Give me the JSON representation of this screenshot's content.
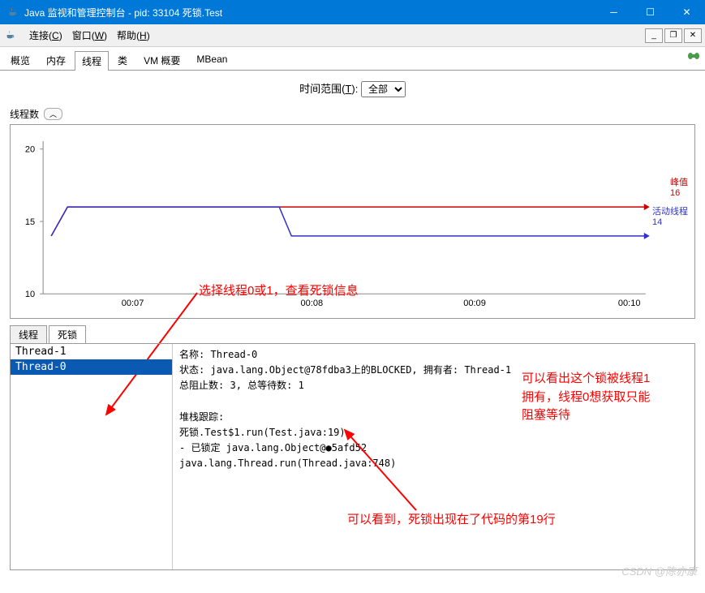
{
  "titlebar": {
    "title": "Java 监视和管理控制台 - pid: 33104 死锁.Test"
  },
  "menubar": {
    "connect": "连接",
    "connect_key": "C",
    "window": "窗口",
    "window_key": "W",
    "help": "帮助",
    "help_key": "H"
  },
  "tabs": {
    "overview": "概览",
    "memory": "内存",
    "threads": "线程",
    "classes": "类",
    "vm": "VM 概要",
    "mbeans": "MBean"
  },
  "time_range": {
    "label": "时间范围(",
    "key": "T",
    "suffix": "):",
    "value": "全部"
  },
  "chart": {
    "title": "线程数",
    "legend_peak": "峰值",
    "legend_peak_val": "16",
    "legend_active": "活动线程",
    "legend_active_val": "14",
    "y_max": "20",
    "y_mid": "15",
    "y_min": "10",
    "x_labels": [
      "00:07",
      "00:08",
      "00:09",
      "00:10"
    ]
  },
  "chart_data": {
    "type": "line",
    "title": "线程数",
    "xlabel": "",
    "ylabel": "",
    "ylim": [
      10,
      20
    ],
    "x": [
      "00:07",
      "00:08",
      "00:09",
      "00:10"
    ],
    "series": [
      {
        "name": "峰值",
        "color": "#cc0000",
        "values": [
          14,
          16,
          16,
          16,
          16
        ]
      },
      {
        "name": "活动线程",
        "color": "#3030cc",
        "values": [
          14,
          16,
          16,
          14,
          14,
          14
        ]
      }
    ]
  },
  "subtabs": {
    "threads": "线程",
    "deadlock": "死锁"
  },
  "thread_list": [
    "Thread-1",
    "Thread-0"
  ],
  "selected_thread": "Thread-0",
  "detail": {
    "name_label": "名称:",
    "name_value": "Thread-0",
    "state_label": "状态:",
    "state_value": "java.lang.Object@78fdba3上的BLOCKED, 拥有者: Thread-1",
    "blocked_label": "总阻止数:",
    "blocked_value": "3,",
    "waited_label": "总等待数:",
    "waited_value": "1",
    "stack_label": "堆栈跟踪:",
    "line1": "死锁.Test$1.run(Test.java:19)",
    "line2": "   - 已锁定 java.lang.Object@",
    "line2_obscured": "5afd52",
    "line3": "java.lang.Thread.run(Thread.java:748)"
  },
  "annotations": {
    "anno1": "选择线程0或1，查看死锁信息",
    "anno2_line1": "可以看出这个锁被线程1",
    "anno2_line2": "拥有，线程0想获取只能",
    "anno2_line3": "阻塞等待",
    "anno3": "可以看到，死锁出现在了代码的第19行"
  },
  "watermark": "CSDN @陈亦康"
}
